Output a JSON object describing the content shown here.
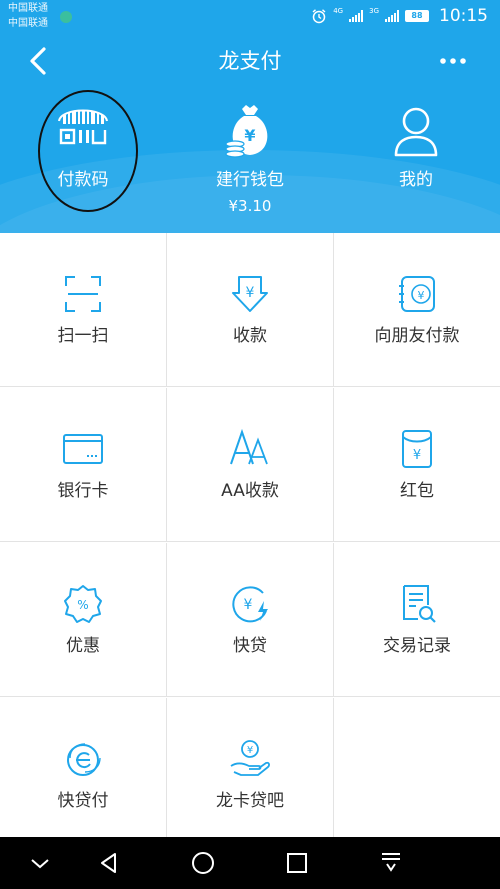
{
  "status_bar": {
    "carrier_1": "中国联通",
    "carrier_2": "中国联通",
    "net_1": "4G",
    "net_2": "3G",
    "battery": "88",
    "time": "10:15"
  },
  "nav": {
    "title": "龙支付",
    "back_icon": "chevron-left-icon",
    "more_icon": "more-dots-icon"
  },
  "features": [
    {
      "label": "付款码",
      "icon": "payment-code-icon"
    },
    {
      "label": "建行钱包",
      "sub": "¥3.10",
      "icon": "wallet-money-bag-icon"
    },
    {
      "label": "我的",
      "icon": "user-icon"
    }
  ],
  "grid": [
    {
      "label": "扫一扫",
      "icon": "scan-icon"
    },
    {
      "label": "收款",
      "icon": "receive-money-icon"
    },
    {
      "label": "向朋友付款",
      "icon": "transfer-friend-icon"
    },
    {
      "label": "银行卡",
      "icon": "bank-card-icon"
    },
    {
      "label": "AA收款",
      "icon": "aa-collect-icon"
    },
    {
      "label": "红包",
      "icon": "red-packet-icon"
    },
    {
      "label": "优惠",
      "icon": "discount-icon"
    },
    {
      "label": "快贷",
      "icon": "quick-loan-icon"
    },
    {
      "label": "交易记录",
      "icon": "transaction-record-icon"
    },
    {
      "label": "快贷付",
      "icon": "quick-loan-pay-icon"
    },
    {
      "label": "龙卡贷吧",
      "icon": "dragon-card-loan-icon"
    }
  ],
  "colors": {
    "brand_blue": "#1fa6ea",
    "icon_blue": "#1fa6ea",
    "grid_line": "#e3e3e3",
    "label_text": "#333333"
  }
}
